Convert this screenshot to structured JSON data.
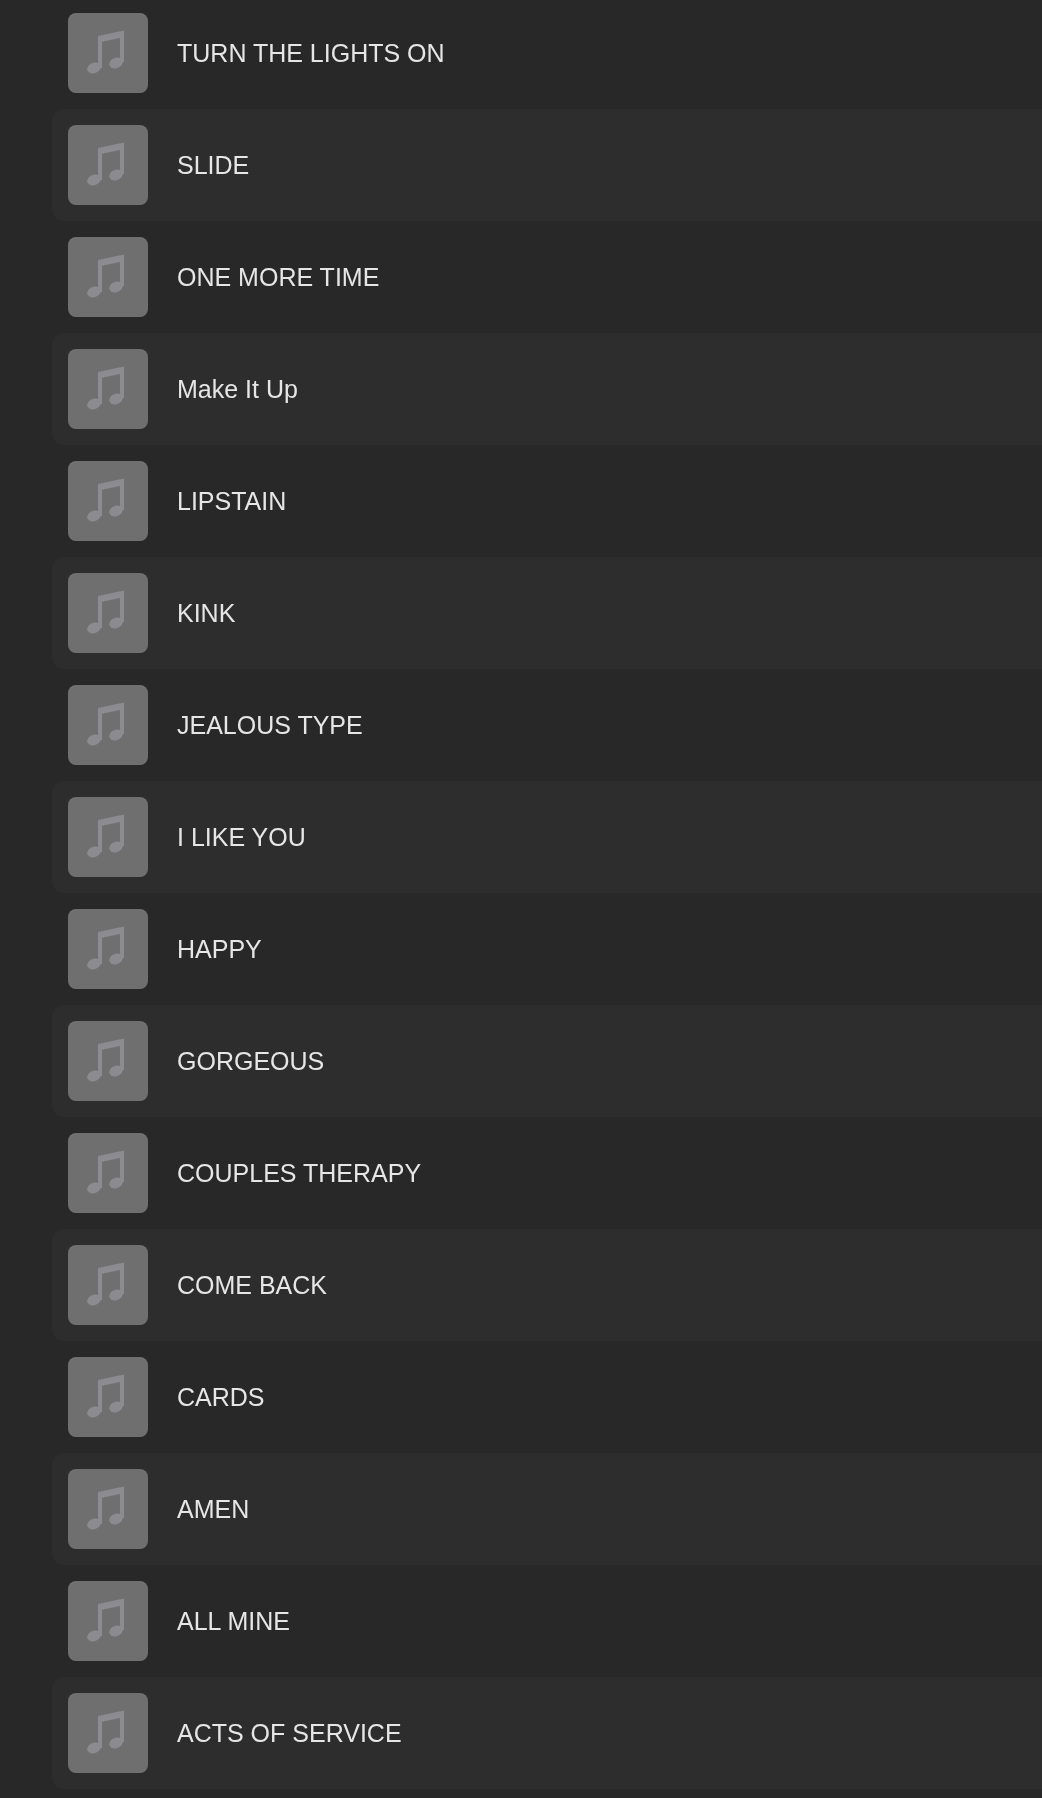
{
  "tracks": [
    {
      "title": "TURN THE LIGHTS ON"
    },
    {
      "title": "SLIDE"
    },
    {
      "title": "ONE MORE TIME"
    },
    {
      "title": "Make It Up"
    },
    {
      "title": "LIPSTAIN"
    },
    {
      "title": "KINK"
    },
    {
      "title": "JEALOUS TYPE"
    },
    {
      "title": "I LIKE YOU"
    },
    {
      "title": "HAPPY"
    },
    {
      "title": "GORGEOUS"
    },
    {
      "title": "COUPLES THERAPY"
    },
    {
      "title": "COME BACK"
    },
    {
      "title": "CARDS"
    },
    {
      "title": "AMEN"
    },
    {
      "title": "ALL MINE"
    },
    {
      "title": "ACTS OF SERVICE"
    }
  ]
}
